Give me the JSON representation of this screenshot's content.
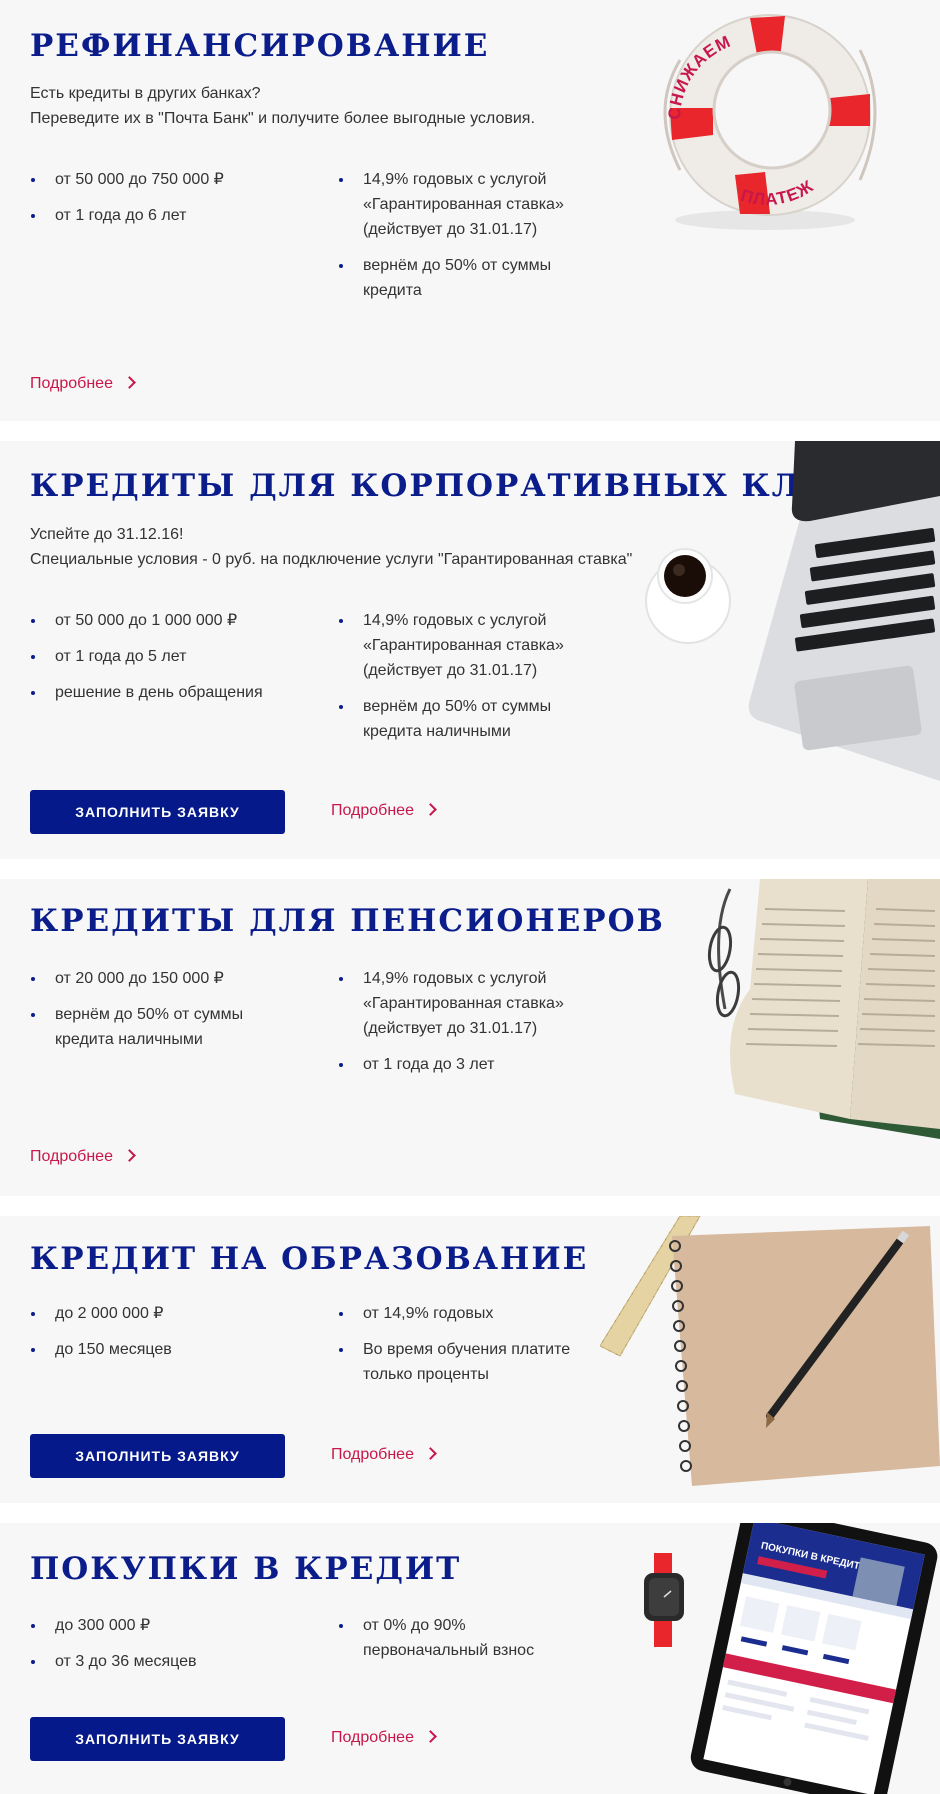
{
  "refinance": {
    "title": "РЕФИНАНСИРОВАНИЕ",
    "intro": [
      "Есть кредиты в других банках?",
      "Переведите их в \"Почта Банк\" и получите более выгодные условия."
    ],
    "left": [
      "от 50 000 до 750 000 ₽",
      "от 1 года до 6 лет"
    ],
    "right": [
      "14,9% годовых с услугой «Гарантированная ставка» (действует до 31.01.17)",
      "вернём до 50% от суммы кредита"
    ],
    "more": "Подробнее",
    "image": {
      "icon": "life-buoy",
      "top_text": "СНИЖАЕМ",
      "bottom_text": "ПЛАТЕЖ"
    }
  },
  "corporate": {
    "title": "КРЕДИТЫ ДЛЯ КОРПОРАТИВНЫХ КЛИЕНТОВ",
    "intro": [
      "Успейте до 31.12.16!",
      "Специальные условия - 0 руб. на подключение услуги \"Гарантированная ставка\""
    ],
    "left": [
      "от 50 000 до 1 000 000 ₽",
      "от 1 года до 5 лет",
      "решение в день обращения"
    ],
    "right": [
      "14,9% годовых с услугой «Гарантированная ставка» (действует до 31.01.17)",
      "вернём до 50% от суммы кредита наличными"
    ],
    "apply": "ЗАПОЛНИТЬ ЗАЯВКУ",
    "more": "Подробнее",
    "image": {
      "icon": "laptop-with-coffee"
    }
  },
  "pensioners": {
    "title": "КРЕДИТЫ ДЛЯ ПЕНСИОНЕРОВ",
    "left": [
      "от 20 000 до 150 000 ₽",
      "вернём до 50% от суммы кредита наличными"
    ],
    "right": [
      "14,9% годовых с услугой «Гарантированная ставка» (действует до 31.01.17)",
      "от 1 года до 3 лет"
    ],
    "more": "Подробнее",
    "image": {
      "icon": "book-with-glasses"
    }
  },
  "education": {
    "title": "КРЕДИТ НА ОБРАЗОВАНИЕ",
    "left": [
      "до 2 000 000 ₽",
      "до 150 месяцев"
    ],
    "right": [
      "от 14,9% годовых",
      "Во время обучения платите только проценты"
    ],
    "apply": "ЗАПОЛНИТЬ ЗАЯВКУ",
    "more": "Подробнее",
    "image": {
      "icon": "notebook-ruler-pencil"
    }
  },
  "purchases": {
    "title": "ПОКУПКИ В КРЕДИТ",
    "left": [
      "до 300 000 ₽",
      "от 3 до 36 месяцев"
    ],
    "right": [
      "от 0% до 90% первоначальный взнос"
    ],
    "apply": "ЗАПОЛНИТЬ ЗАЯВКУ",
    "more": "Подробнее",
    "image": {
      "icon": "tablet-and-watch",
      "screen_title": "ПОКУПКИ В КРЕДИТ"
    }
  },
  "colors": {
    "accent": "#0b1d8a",
    "link": "#c8174a",
    "button": "#06198a",
    "card_bg": "#f7f7f8"
  }
}
